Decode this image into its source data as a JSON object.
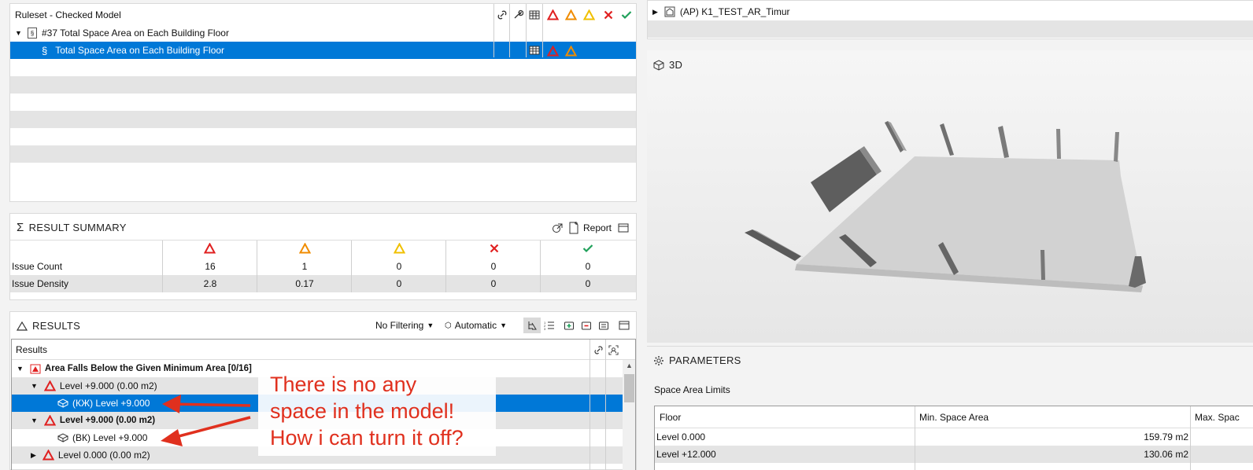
{
  "ruleset": {
    "header_title": "Ruleset - Checked Model",
    "rule_group": "#37 Total Space Area on Each Building Floor",
    "rule_item": "Total Space Area on Each Building Floor"
  },
  "summary": {
    "title": "RESULT SUMMARY",
    "report_label": "Report",
    "rows": [
      {
        "label": "Issue Count",
        "values": [
          "16",
          "1",
          "0",
          "0",
          "0"
        ]
      },
      {
        "label": "Issue Density",
        "values": [
          "2.8",
          "0.17",
          "0",
          "0",
          "0"
        ]
      }
    ]
  },
  "results": {
    "title": "RESULTS",
    "filter_label": "No Filtering",
    "mode_label": "Automatic",
    "column_header": "Results",
    "group_label": "Area Falls Below the Given Minimum Area [0/16]",
    "items": [
      {
        "label": "Level  +9.000 (0.00 m2)"
      },
      {
        "label": "(КЖ) Level  +9.000"
      },
      {
        "label": "Level  +9.000 (0.00 m2)"
      },
      {
        "label": "(ВК) Level  +9.000"
      },
      {
        "label": "Level  0.000 (0.00 m2)"
      }
    ]
  },
  "annotation": {
    "line1": "There is no any",
    "line2": "space in the model!",
    "line3": "How i can turn it off?"
  },
  "model_tree": {
    "root_label": "(AP) K1_TEST_AR_Timur"
  },
  "view3d": {
    "title": "3D"
  },
  "parameters": {
    "title": "PARAMETERS",
    "section_label": "Space Area Limits",
    "columns": [
      "Floor",
      "Min. Space Area",
      "Max. Spac"
    ],
    "rows": [
      {
        "floor": "Level  0.000",
        "min": "159.79 m2"
      },
      {
        "floor": "Level +12.000",
        "min": "130.06 m2"
      }
    ]
  },
  "colors": {
    "selection": "#0078d7",
    "critical": "#e02020",
    "major": "#f08c00",
    "moderate": "#f0c000",
    "ok": "#1fa05a",
    "annotation": "#e0301e"
  }
}
